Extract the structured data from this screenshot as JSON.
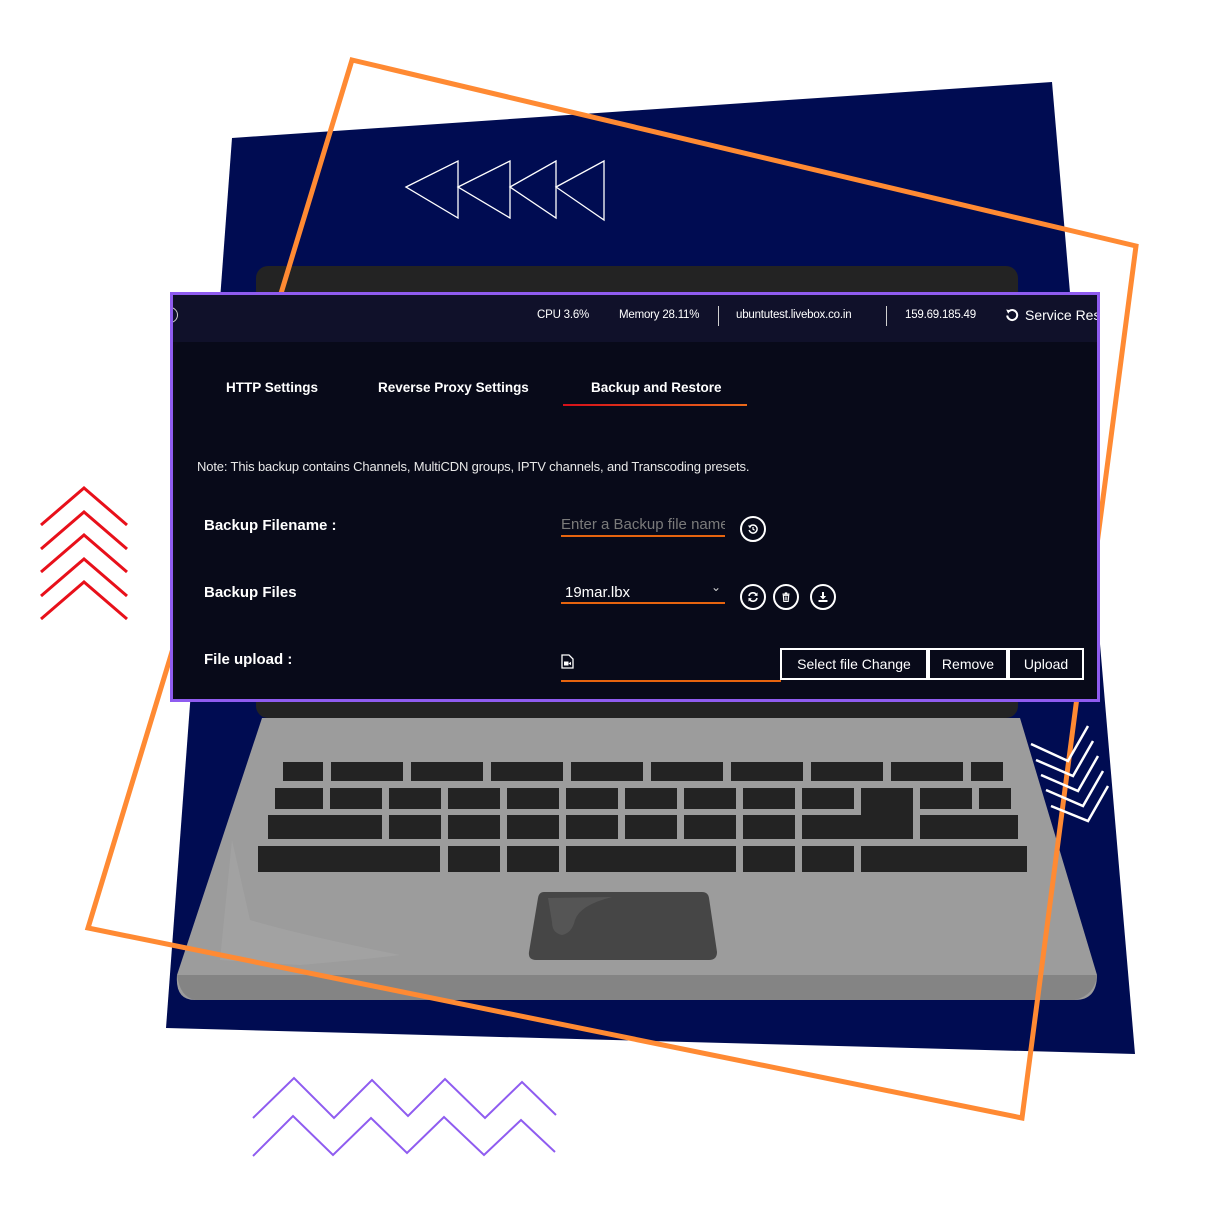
{
  "topbar": {
    "cpu": "CPU 3.6%",
    "memory": "Memory 28.11%",
    "host": "ubuntutest.livebox.co.in",
    "ip": "159.69.185.49",
    "service_restart": "Service Res",
    "service_restart_icon": "restart-icon"
  },
  "tabs": [
    {
      "label": "HTTP Settings",
      "active": false
    },
    {
      "label": "Reverse Proxy Settings",
      "active": false
    },
    {
      "label": "Backup and Restore",
      "active": true
    }
  ],
  "note": "Note: This backup contains Channels, MultiCDN groups, IPTV channels, and Transcoding presets.",
  "form": {
    "backup_filename": {
      "label": "Backup Filename :",
      "value": "",
      "placeholder": "Enter a Backup file name",
      "action_icon": "backup-create-icon"
    },
    "backup_files": {
      "label": "Backup Files",
      "selected": "19mar.lbx",
      "actions": [
        "refresh-icon",
        "trash-icon",
        "download-icon"
      ]
    },
    "file_upload": {
      "label": "File upload :",
      "file_icon": "video-file-icon",
      "buttons": {
        "select": "Select file Change",
        "remove": "Remove",
        "upload": "Upload"
      }
    }
  },
  "colors": {
    "accent_orange": "#e6640f",
    "frame_purple": "#8f5cf0",
    "background_navy": "#000c52",
    "decor_orange": "#ff8a33",
    "decor_red": "#e8101a",
    "tab_underline_start": "#d6101a"
  }
}
